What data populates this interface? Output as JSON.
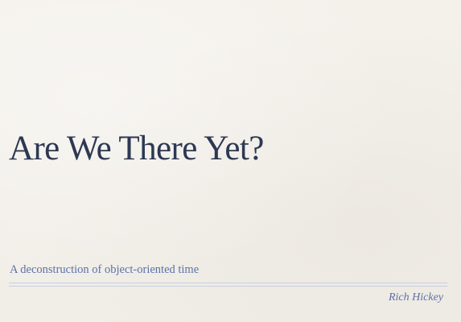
{
  "slide": {
    "title": "Are We There Yet?",
    "subtitle": "A deconstruction of object-oriented time",
    "author": "Rich Hickey"
  },
  "colors": {
    "background": "#f3f0ea",
    "title": "#2d3852",
    "accent": "#5b72a7",
    "rule": "#c7cfe0"
  }
}
